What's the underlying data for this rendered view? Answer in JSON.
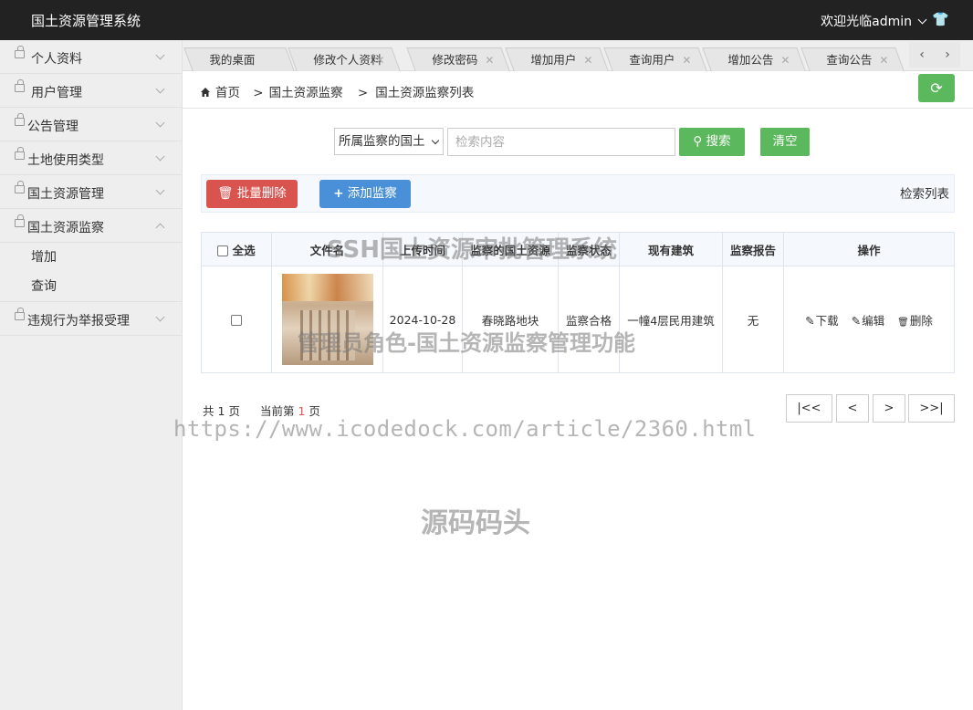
{
  "header": {
    "app_title": "国土资源管理系统",
    "welcome": "欢迎光临admin",
    "shirt_icon": "👕"
  },
  "sidebar": {
    "items": [
      {
        "label": "个人资料",
        "expanded": false
      },
      {
        "label": "用户管理",
        "expanded": false
      },
      {
        "label": "公告管理",
        "expanded": false
      },
      {
        "label": "土地使用类型",
        "expanded": false
      },
      {
        "label": "国土资源管理",
        "expanded": false
      },
      {
        "label": "国土资源监察",
        "expanded": true,
        "children": [
          "增加",
          "查询"
        ]
      },
      {
        "label": "违规行为举报受理",
        "expanded": false
      }
    ]
  },
  "tabs": [
    {
      "label": "我的桌面",
      "closable": false
    },
    {
      "label": "修改个人资料",
      "closable": true
    },
    {
      "label": "修改密码",
      "closable": true
    },
    {
      "label": "增加用户",
      "closable": true
    },
    {
      "label": "查询用户",
      "closable": true
    },
    {
      "label": "增加公告",
      "closable": true
    },
    {
      "label": "查询公告",
      "closable": true
    }
  ],
  "tab_nav": {
    "prev": "‹",
    "next": "›"
  },
  "breadcrumb": {
    "home": "首页",
    "sep": ">",
    "level1": "国土资源监察",
    "level2": "国土资源监察列表"
  },
  "search": {
    "select_value": "所属监察的国土",
    "placeholder": "检索内容",
    "search_label": "搜索",
    "clear_label": "清空"
  },
  "toolbar": {
    "batch_delete": "批量删除",
    "add_label": "添加监察",
    "list_title": "检索列表"
  },
  "table": {
    "headers": [
      "全选",
      "文件名",
      "上传时间",
      "监察的国土资源",
      "监察状态",
      "现有建筑",
      "监察报告",
      "操作"
    ],
    "rows": [
      {
        "upload_time": "2024-10-28",
        "resource": "春晓路地块",
        "status": "监察合格",
        "building": "一幢4层民用建筑",
        "report": "无",
        "ops": [
          "下载",
          "编辑",
          "删除"
        ]
      }
    ]
  },
  "pager": {
    "total_prefix": "共",
    "total": "1",
    "total_suffix": "页",
    "cur_prefix": "当前第",
    "current": "1",
    "cur_suffix": "页",
    "first": "|<<",
    "prev": "<",
    "next": ">",
    "last": ">>|"
  },
  "watermarks": {
    "line1": "SSH国土资源审批管理系统",
    "line2": "管理员角色-国土资源监察管理功能",
    "url": "https://www.icodedock.com/article/2360.html",
    "brand": "源码码头"
  },
  "colors": {
    "topbar": "#222222",
    "green": "#5cb85c",
    "red": "#d9534f",
    "blue": "#4a90d9"
  }
}
